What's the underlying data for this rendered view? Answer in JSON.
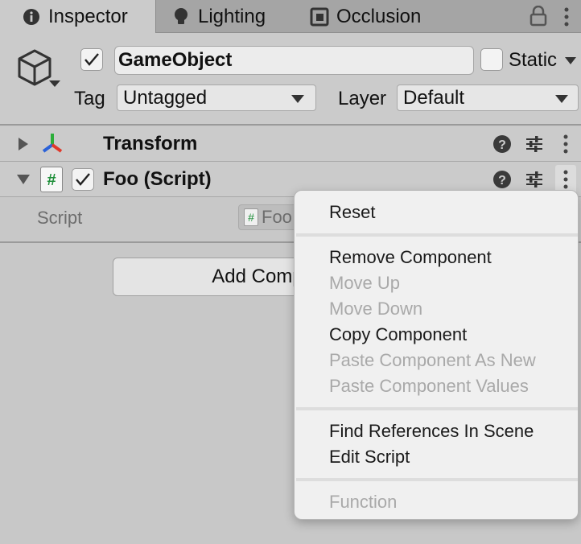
{
  "tabs": [
    {
      "label": "Inspector",
      "icon": "info-icon",
      "active": true
    },
    {
      "label": "Lighting",
      "icon": "bulb-icon",
      "active": false
    },
    {
      "label": "Occlusion",
      "icon": "occlusion-icon",
      "active": false
    }
  ],
  "header": {
    "object_name": "GameObject",
    "active_checked": true,
    "static_label": "Static",
    "static_checked": false,
    "tag_label": "Tag",
    "tag_value": "Untagged",
    "layer_label": "Layer",
    "layer_value": "Default"
  },
  "components": [
    {
      "title": "Transform",
      "expanded": false,
      "icon": "transform-icon"
    },
    {
      "title": "Foo (Script)",
      "expanded": true,
      "enabled": true,
      "icon": "script-icon"
    }
  ],
  "script_field": {
    "label": "Script",
    "value": "Foo"
  },
  "add_component_label": "Add Component",
  "context_menu": {
    "items": [
      {
        "label": "Reset",
        "enabled": true
      },
      {
        "label": "Remove Component",
        "enabled": true
      },
      {
        "label": "Move Up",
        "enabled": false
      },
      {
        "label": "Move Down",
        "enabled": false
      },
      {
        "label": "Copy Component",
        "enabled": true
      },
      {
        "label": "Paste Component As New",
        "enabled": false
      },
      {
        "label": "Paste Component Values",
        "enabled": false
      },
      {
        "label": "Find References In Scene",
        "enabled": true
      },
      {
        "label": "Edit Script",
        "enabled": true
      },
      {
        "label": "Function",
        "enabled": false
      }
    ]
  },
  "colors": {
    "panel_bg": "#cbcbcb",
    "tab_bar_bg": "#a5a5a5",
    "menu_bg": "#f0f0f0",
    "disabled_text": "#a9a9a9",
    "transform_x": "#e0392b",
    "transform_y": "#2cae3a",
    "transform_z": "#2b62d8",
    "script_hash": "#1f8f3a"
  }
}
